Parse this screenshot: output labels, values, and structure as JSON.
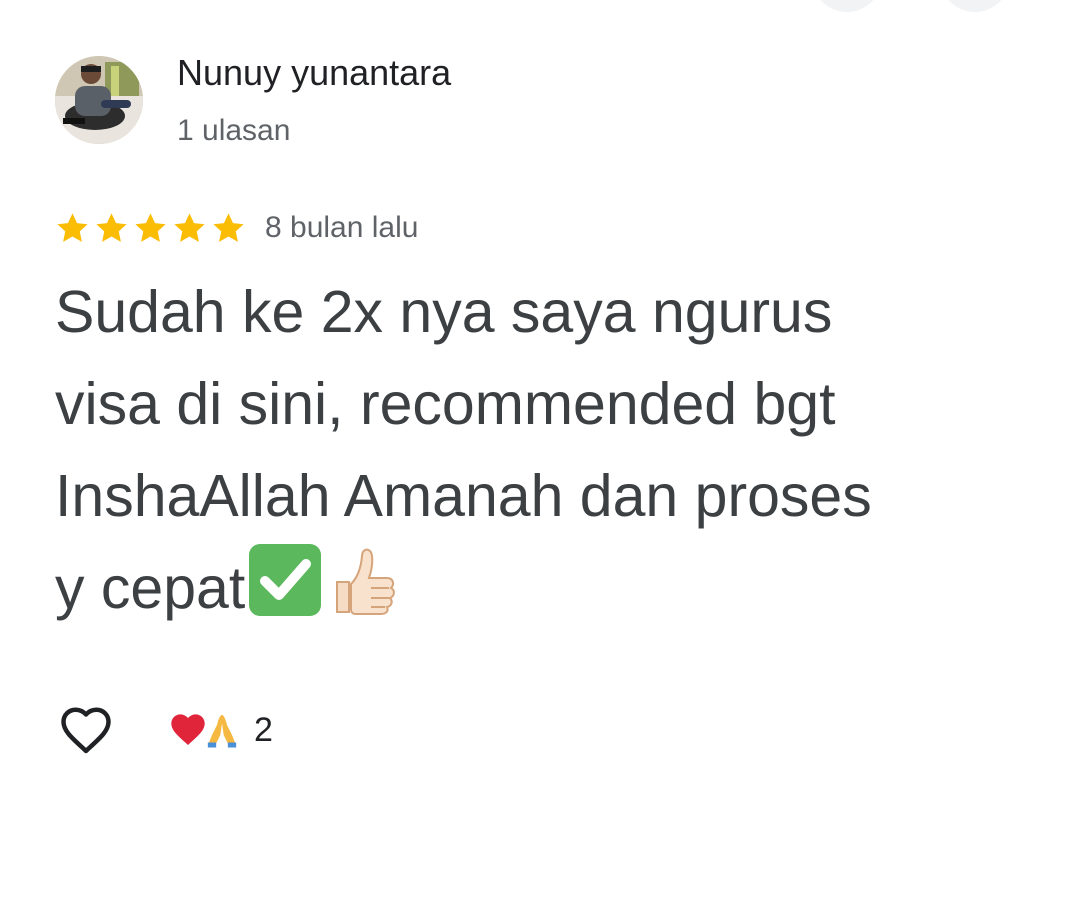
{
  "review": {
    "author": "Nunuy yunantara",
    "author_meta": "1 ulasan",
    "rating": 5,
    "rating_max": 5,
    "time_ago": "8 bulan lalu",
    "text": "Sudah ke 2x nya saya ngurus\nvisa di sini, recommended bgt\nInshaAllah Amanah dan proses\ny cepat",
    "reactions": {
      "icons": [
        "heart-emoji",
        "folded-hands-emoji"
      ],
      "count": "2"
    }
  },
  "colors": {
    "star": "#fbbc04",
    "text": "#3c4043",
    "secondary": "#5f6368",
    "check_green": "#5cb85c"
  },
  "icons": [
    "heart-outline-icon",
    "star-icon",
    "check-mark-emoji",
    "thumbs-up-emoji"
  ]
}
